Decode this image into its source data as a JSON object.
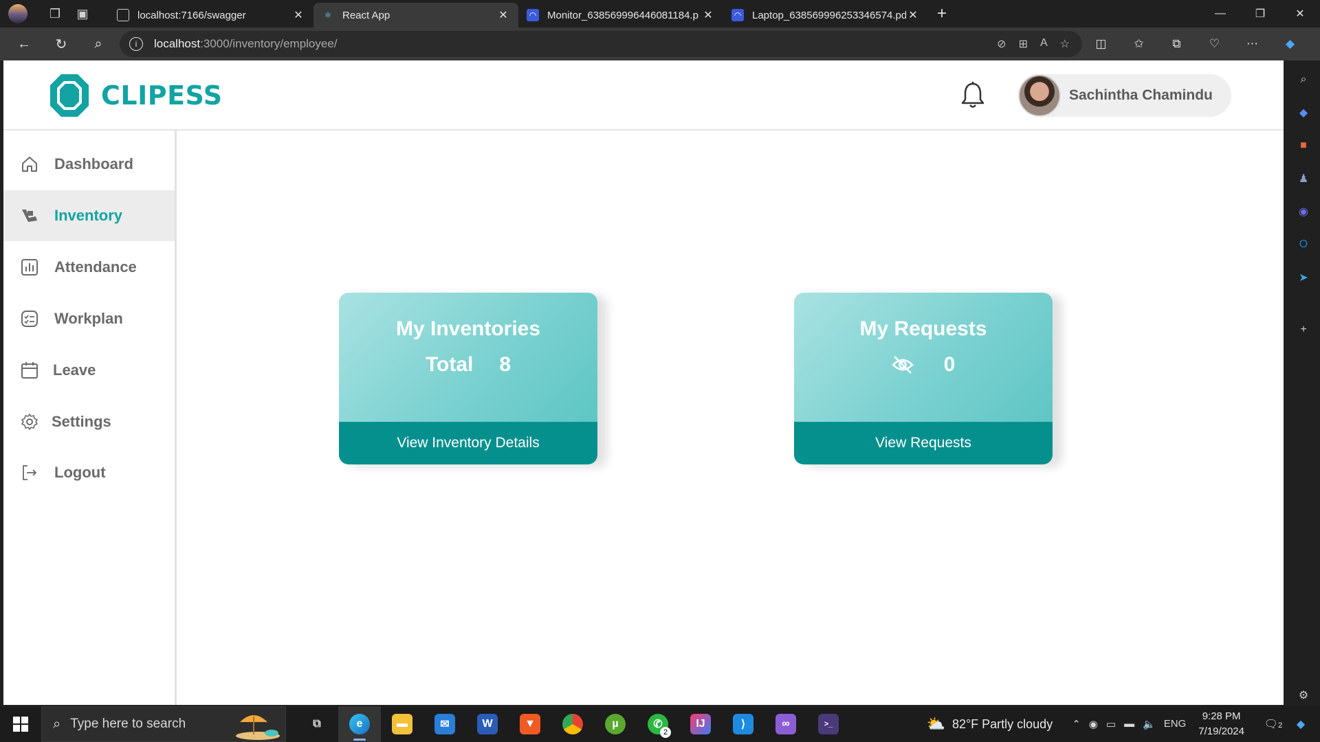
{
  "browser": {
    "tabs": [
      {
        "title": "localhost:7166/swagger",
        "close": "✕"
      },
      {
        "title": "React App",
        "close": "✕"
      },
      {
        "title": "Monitor_638569996446081184.p",
        "close": "✕"
      },
      {
        "title": "Laptop_638569996253346574.pd",
        "close": "✕"
      }
    ],
    "new_tab": "+",
    "url_host": "localhost",
    "url_path": ":3000/inventory/employee/"
  },
  "app": {
    "brand": "CLIPESS",
    "user_name": "Sachintha Chamindu",
    "sidebar": [
      {
        "label": "Dashboard",
        "icon": "home-icon"
      },
      {
        "label": "Inventory",
        "icon": "inventory-icon",
        "active": true
      },
      {
        "label": "Attendance",
        "icon": "chart-icon"
      },
      {
        "label": "Workplan",
        "icon": "checklist-icon"
      },
      {
        "label": "Leave",
        "icon": "calendar-icon"
      },
      {
        "label": "Settings",
        "icon": "gear-icon"
      },
      {
        "label": "Logout",
        "icon": "logout-icon"
      }
    ],
    "cards": [
      {
        "title": "My Inventories",
        "stat_label": "Total",
        "stat_value": "8",
        "button": "View Inventory Details"
      },
      {
        "title": "My Requests",
        "stat_icon": "eye-off-icon",
        "stat_value": "0",
        "button": "View Requests"
      }
    ],
    "accent": "#13a3a3",
    "button_color": "#05908e"
  },
  "taskbar": {
    "search_placeholder": "Type here to search",
    "weather": "82°F  Partly cloudy",
    "lang": "ENG",
    "time": "9:28 PM",
    "date": "7/19/2024",
    "notif_count": "2",
    "whatsapp_badge": "2"
  }
}
